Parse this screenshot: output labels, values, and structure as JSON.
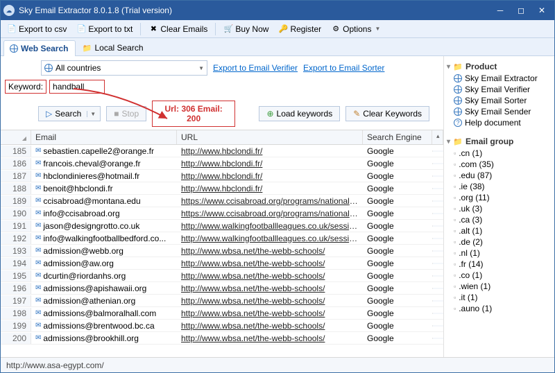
{
  "title": "Sky Email Extractor 8.0.1.8 (Trial version)",
  "toolbar": {
    "export_csv": "Export to csv",
    "export_txt": "Export to txt",
    "clear_emails": "Clear Emails",
    "buy_now": "Buy Now",
    "register": "Register",
    "options": "Options"
  },
  "tabs": {
    "web": "Web Search",
    "local": "Local Search"
  },
  "country": "All countries",
  "links": {
    "verifier": "Export to Email Verifier",
    "sorter": "Export to Email Sorter"
  },
  "keyword_label": "Keyword:",
  "keyword_value": "handball",
  "buttons": {
    "search": "Search",
    "stop": "Stop",
    "load_kw": "Load keywords",
    "clear_kw": "Clear Keywords"
  },
  "statline": "Url: 306 Email: 200",
  "grid_headers": {
    "email": "Email",
    "url": "URL",
    "se": "Search Engine"
  },
  "rows": [
    {
      "n": 185,
      "e": "sebastien.capelle2@orange.fr",
      "u": "http://www.hbclondi.fr/",
      "s": "Google"
    },
    {
      "n": 186,
      "e": "francois.cheval@orange.fr",
      "u": "http://www.hbclondi.fr/",
      "s": "Google"
    },
    {
      "n": 187,
      "e": "hbclondinieres@hotmail.fr",
      "u": "http://www.hbclondi.fr/",
      "s": "Google"
    },
    {
      "n": 188,
      "e": "benoit@hbclondi.fr",
      "u": "http://www.hbclondi.fr/",
      "s": "Google"
    },
    {
      "n": 189,
      "e": "ccisabroad@montana.edu",
      "u": "https://www.ccisabroad.org/programs/national-u...",
      "s": "Google"
    },
    {
      "n": 190,
      "e": "info@ccisabroad.org",
      "u": "https://www.ccisabroad.org/programs/national-u...",
      "s": "Google"
    },
    {
      "n": 191,
      "e": "jason@designgrotto.co.uk",
      "u": "http://www.walkingfootballleagues.co.uk/sessions...",
      "s": "Google"
    },
    {
      "n": 192,
      "e": "info@walkingfootballbedford.co...",
      "u": "http://www.walkingfootballleagues.co.uk/sessions...",
      "s": "Google"
    },
    {
      "n": 193,
      "e": "admission@webb.org",
      "u": "http://www.wbsa.net/the-webb-schools/",
      "s": "Google"
    },
    {
      "n": 194,
      "e": "admission@aw.org",
      "u": "http://www.wbsa.net/the-webb-schools/",
      "s": "Google"
    },
    {
      "n": 195,
      "e": "dcurtin@riordanhs.org",
      "u": "http://www.wbsa.net/the-webb-schools/",
      "s": "Google"
    },
    {
      "n": 196,
      "e": "admissions@apishawaii.org",
      "u": "http://www.wbsa.net/the-webb-schools/",
      "s": "Google"
    },
    {
      "n": 197,
      "e": "admission@athenian.org",
      "u": "http://www.wbsa.net/the-webb-schools/",
      "s": "Google"
    },
    {
      "n": 198,
      "e": "admissions@balmoralhall.com",
      "u": "http://www.wbsa.net/the-webb-schools/",
      "s": "Google"
    },
    {
      "n": 199,
      "e": "admissions@brentwood.bc.ca",
      "u": "http://www.wbsa.net/the-webb-schools/",
      "s": "Google"
    },
    {
      "n": 200,
      "e": "admissions@brookhill.org",
      "u": "http://www.wbsa.net/the-webb-schools/",
      "s": "Google"
    }
  ],
  "status_text": "http://www.asa-egypt.com/",
  "side": {
    "product_header": "Product",
    "products": [
      "Sky Email Extractor",
      "Sky Email Verifier",
      "Sky Email Sorter",
      "Sky Email Sender",
      "Help document"
    ],
    "group_header": "Email group",
    "groups": [
      ".cn (1)",
      ".com (35)",
      ".edu (87)",
      ".ie (38)",
      ".org (11)",
      ".uk (3)",
      ".ca (3)",
      ".alt (1)",
      ".de (2)",
      ".nl (1)",
      ".fr (14)",
      ".co (1)",
      ".wien (1)",
      ".it (1)",
      ".auno (1)"
    ]
  }
}
